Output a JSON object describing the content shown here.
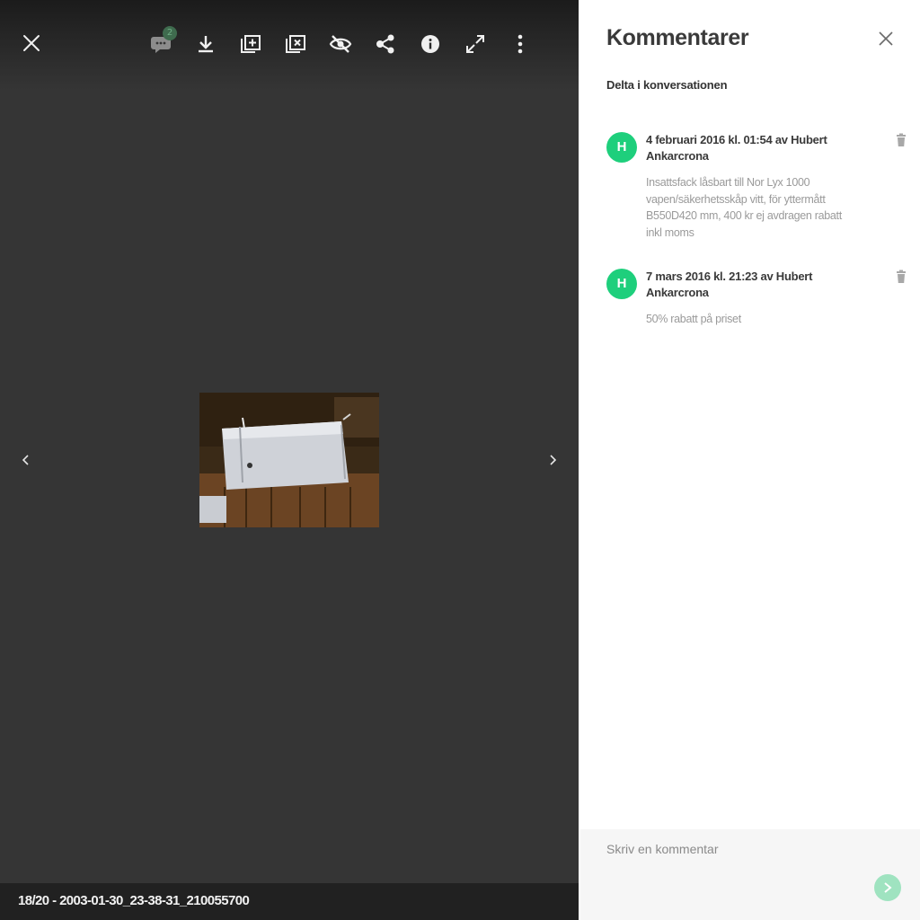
{
  "viewer": {
    "toolbar": {
      "close_icon": "close-icon",
      "comment_icon": "comment-icon",
      "comment_count": "2",
      "icons": [
        "download-icon",
        "add-to-collection-icon",
        "remove-from-collection-icon",
        "hide-icon",
        "share-icon",
        "info-icon",
        "fullscreen-icon",
        "more-icon"
      ]
    },
    "nav": {
      "prev_icon": "chevron-left-icon",
      "next_icon": "chevron-right-icon"
    },
    "footer": {
      "caption": "18/20 - 2003-01-30_23-38-31_210055700"
    }
  },
  "comments_panel": {
    "title": "Kommentarer",
    "subtitle": "Delta i konversationen",
    "items": [
      {
        "avatar_letter": "H",
        "header": "4 februari 2016 kl. 01:54 av Hubert Ankarcrona",
        "body": "Insattsfack låsbart till Nor Lyx 1000 vapen/säkerhetsskåp vitt, för yttermått B550D420 mm, 400 kr ej avdragen rabatt inkl moms"
      },
      {
        "avatar_letter": "H",
        "header": "7 mars 2016 kl. 21:23 av Hubert Ankarcrona",
        "body": "50% rabatt på priset"
      }
    ],
    "composer": {
      "placeholder": "Skriv en kommentar"
    }
  },
  "colors": {
    "avatar": "#1ecf7c",
    "send": "#9fe3c0",
    "viewer_bg": "#353535",
    "footer_bg": "#212121"
  }
}
